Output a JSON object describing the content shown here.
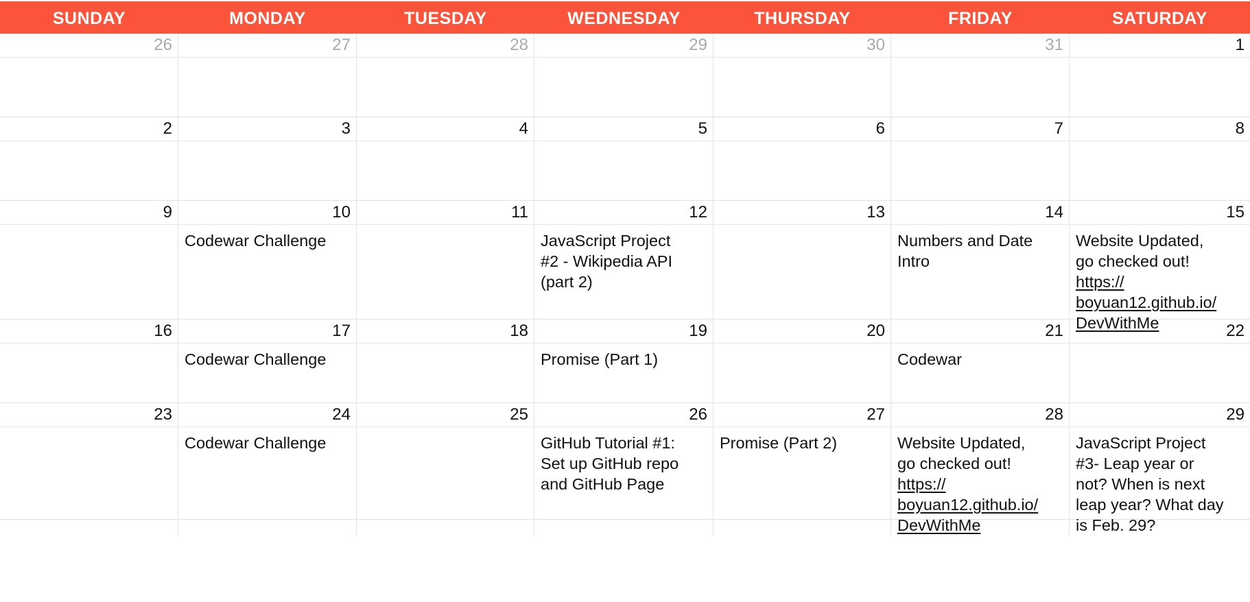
{
  "header": {
    "days": [
      "SUNDAY",
      "MONDAY",
      "TUESDAY",
      "WEDNESDAY",
      "THURSDAY",
      "FRIDAY",
      "SATURDAY"
    ],
    "color": "#fc543b"
  },
  "weeks": [
    {
      "dates": [
        "26",
        "27",
        "28",
        "29",
        "30",
        "31",
        "1"
      ],
      "muted": [
        true,
        true,
        true,
        true,
        true,
        true,
        false
      ],
      "events": [
        [],
        [],
        [],
        [],
        [],
        [],
        []
      ]
    },
    {
      "dates": [
        "2",
        "3",
        "4",
        "5",
        "6",
        "7",
        "8"
      ],
      "muted": [
        false,
        false,
        false,
        false,
        false,
        false,
        false
      ],
      "events": [
        [],
        [],
        [],
        [],
        [],
        [],
        []
      ]
    },
    {
      "dates": [
        "9",
        "10",
        "11",
        "12",
        "13",
        "14",
        "15"
      ],
      "muted": [
        false,
        false,
        false,
        false,
        false,
        false,
        false
      ],
      "events": [
        [],
        [
          {
            "type": "text",
            "lines": [
              "Codewar Challenge"
            ]
          }
        ],
        [],
        [
          {
            "type": "text",
            "lines": [
              "JavaScript Project",
              "#2 - Wikipedia API",
              "(part 2)"
            ]
          }
        ],
        [],
        [
          {
            "type": "text",
            "lines": [
              "Numbers and Date",
              "Intro"
            ]
          }
        ],
        [
          {
            "type": "text",
            "lines": [
              "Website Updated,",
              "go checked out!"
            ]
          },
          {
            "type": "link",
            "lines": [
              "https://",
              "boyuan12.github.io/",
              "DevWithMe"
            ]
          }
        ]
      ]
    },
    {
      "dates": [
        "16",
        "17",
        "18",
        "19",
        "20",
        "21",
        "22"
      ],
      "muted": [
        false,
        false,
        false,
        false,
        false,
        false,
        false
      ],
      "events": [
        [],
        [
          {
            "type": "text",
            "lines": [
              "Codewar Challenge"
            ]
          }
        ],
        [],
        [
          {
            "type": "text",
            "lines": [
              "Promise (Part 1)"
            ]
          }
        ],
        [],
        [
          {
            "type": "text",
            "lines": [
              "Codewar"
            ]
          }
        ],
        []
      ]
    },
    {
      "dates": [
        "23",
        "24",
        "25",
        "26",
        "27",
        "28",
        "29"
      ],
      "muted": [
        false,
        false,
        false,
        false,
        false,
        false,
        false
      ],
      "events": [
        [],
        [
          {
            "type": "text",
            "lines": [
              "Codewar Challenge"
            ]
          }
        ],
        [],
        [
          {
            "type": "text",
            "lines": [
              "GitHub Tutorial #1:",
              "Set up GitHub repo",
              "and GitHub Page"
            ]
          }
        ],
        [
          {
            "type": "text",
            "lines": [
              "Promise (Part 2)"
            ]
          }
        ],
        [
          {
            "type": "text",
            "lines": [
              "Website Updated,",
              "go checked out!"
            ]
          },
          {
            "type": "link",
            "lines": [
              "https://",
              "boyuan12.github.io/",
              "DevWithMe"
            ]
          }
        ],
        [
          {
            "type": "text",
            "lines": [
              "JavaScript Project",
              "#3- Leap year or",
              "not? When is next",
              "leap year? What day",
              "is Feb. 29?"
            ]
          }
        ]
      ]
    }
  ]
}
